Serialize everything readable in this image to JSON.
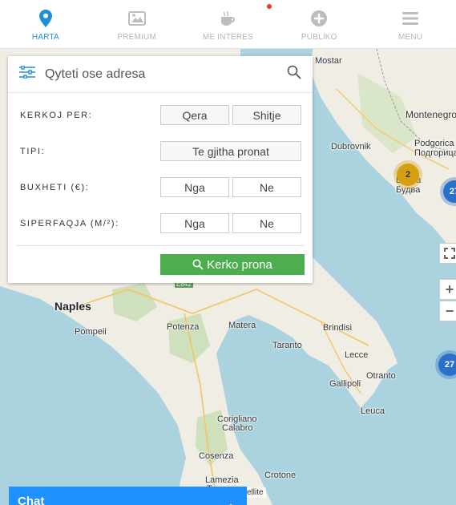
{
  "nav": {
    "items": [
      {
        "label": "HARTA",
        "icon": "map-pin-icon",
        "active": true
      },
      {
        "label": "PREMIUM",
        "icon": "image-gallery-icon",
        "active": false
      },
      {
        "label": "ME INTERES",
        "icon": "coffee-cup-icon",
        "active": false
      },
      {
        "label": "PUBLIKO",
        "icon": "plus-circle-icon",
        "active": false
      },
      {
        "label": "MENU",
        "icon": "hamburger-menu-icon",
        "active": false
      }
    ],
    "notification_color": "#e53935",
    "active_color": "#1e8fd8"
  },
  "search": {
    "placeholder": "Qyteti ose adresa",
    "kerkoj_label": "KERKOJ PER:",
    "kerkoj_options": [
      "Qera",
      "Shitje"
    ],
    "tipi_label": "TIPI:",
    "tipi_value": "Te gjitha pronat",
    "buxheti_label": "BUXHETI (€):",
    "buxheti_from": "Nga",
    "buxheti_to": "Ne",
    "siperfaqja_label": "SIPERFAQJA (M/²):",
    "siperfaqja_from": "Nga",
    "siperfaqja_to": "Ne",
    "submit_label": "Kerko prona",
    "submit_color": "#4cae4f"
  },
  "map": {
    "places": [
      {
        "name": "Mostar",
        "cls": ""
      },
      {
        "name": "Montenegro",
        "cls": "mid"
      },
      {
        "name": "Podgorica",
        "cls": ""
      },
      {
        "name": "Подгорица",
        "cls": ""
      },
      {
        "name": "Dubrovnik",
        "cls": ""
      },
      {
        "name": "Budva",
        "cls": ""
      },
      {
        "name": "Будва",
        "cls": ""
      },
      {
        "name": "Naples",
        "cls": "big"
      },
      {
        "name": "Pompeii",
        "cls": ""
      },
      {
        "name": "Potenza",
        "cls": ""
      },
      {
        "name": "Matera",
        "cls": ""
      },
      {
        "name": "Brindisi",
        "cls": ""
      },
      {
        "name": "Taranto",
        "cls": ""
      },
      {
        "name": "Lecce",
        "cls": ""
      },
      {
        "name": "Otranto",
        "cls": ""
      },
      {
        "name": "Gallipoli",
        "cls": ""
      },
      {
        "name": "Leuca",
        "cls": ""
      },
      {
        "name": "Corigliano",
        "cls": ""
      },
      {
        "name": "Calabro",
        "cls": ""
      },
      {
        "name": "Cosenza",
        "cls": ""
      },
      {
        "name": "Crotone",
        "cls": ""
      },
      {
        "name": "Lamezia",
        "cls": ""
      },
      {
        "name": "Terme",
        "cls": ""
      },
      {
        "name": "E842",
        "cls": ""
      }
    ],
    "clusters": [
      {
        "count": "2",
        "color": "#d4a012"
      },
      {
        "count": "27",
        "color": "#2a6fc9"
      },
      {
        "count": "27",
        "color": "#2a6fc9"
      }
    ],
    "attribution": "ellite",
    "sea_color": "#aad3df",
    "land_color": "#f0ede4"
  },
  "chat": {
    "title": "Chat",
    "color": "#1e90ff"
  }
}
